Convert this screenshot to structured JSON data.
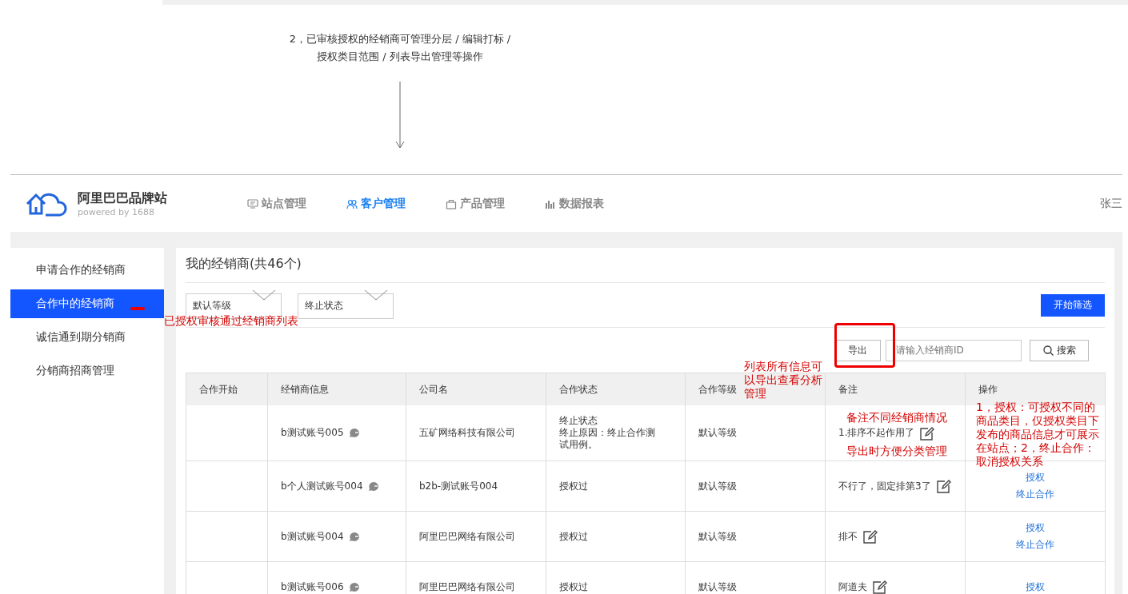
{
  "top_note": {
    "lines": [
      "2，已审核授权的经销商可管理分层 / 编辑打标 /",
      "授权类目范围 / 列表导出管理等操作"
    ]
  },
  "brand": {
    "name": "阿里巴巴品牌站",
    "tagline": "powered by 1688"
  },
  "nav": [
    {
      "label": "站点管理",
      "kind": "monitor",
      "selected": false
    },
    {
      "label": "客户管理",
      "kind": "users",
      "selected": true
    },
    {
      "label": "产品管理",
      "kind": "bag",
      "selected": false
    },
    {
      "label": "数据报表",
      "kind": "chart",
      "selected": false
    }
  ],
  "user": "张三",
  "sidebar": {
    "items": [
      {
        "label": "申请合作的经销商",
        "selected": false
      },
      {
        "label": "合作中的经销商",
        "selected": true
      },
      {
        "label": "诚信通到期分销商",
        "selected": false
      },
      {
        "label": "分销商招商管理",
        "selected": false
      }
    ]
  },
  "panel": {
    "title": "我的经销商(共46个)",
    "filters": [
      {
        "value": "默认等级"
      },
      {
        "value": "终止状态"
      }
    ],
    "filter_button": "开始筛选",
    "export_button": "导出",
    "search": {
      "placeholder": "请输入经销商ID"
    },
    "search_button": "搜索"
  },
  "table": {
    "columns": [
      "合作开始",
      "经销商信息",
      "公司名",
      "合作状态",
      "合作等级",
      "备注",
      "操作"
    ],
    "rows": [
      {
        "start": "",
        "dealer": "b测试账号005",
        "company": "五矿网络科技有限公司",
        "status": [
          "终止状态",
          "终止原因：终止合作测试用例。"
        ],
        "level": "默认等级",
        "note": "1.排序不起作用了",
        "actions": []
      },
      {
        "start": "",
        "dealer": "b个人测试账号004",
        "company": "b2b-测试账号004",
        "status": [
          "授权过"
        ],
        "level": "默认等级",
        "note": "不行了，固定排第3了",
        "actions": [
          "授权",
          "终止合作"
        ]
      },
      {
        "start": "",
        "dealer": "b测试账号004",
        "company": "阿里巴巴网络有限公司",
        "status": [
          "授权过"
        ],
        "level": "默认等级",
        "note": "排不",
        "actions": [
          "授权",
          "终止合作"
        ]
      },
      {
        "start": "",
        "dealer": "b测试账号006",
        "company": "阿里巴巴网络有限公司",
        "status": [
          "授权过"
        ],
        "level": "默认等级",
        "note": "阿道夫",
        "actions": [
          "授权"
        ]
      }
    ]
  },
  "annotations": [
    {
      "kind": "sidebar",
      "text": "已授权审核通过经销商列表"
    },
    {
      "kind": "export",
      "text": "列表所有信息可以导出查看分析管理"
    },
    {
      "kind": "note",
      "text": "备注不同经销商情况"
    },
    {
      "kind": "note2",
      "text": "导出时方便分类管理"
    },
    {
      "kind": "actions",
      "text": "1，授权：可授权不同的商品类目，仅授权类目下发布的商品信息才可展示在站点；2，终止合作：取消授权关系"
    }
  ]
}
